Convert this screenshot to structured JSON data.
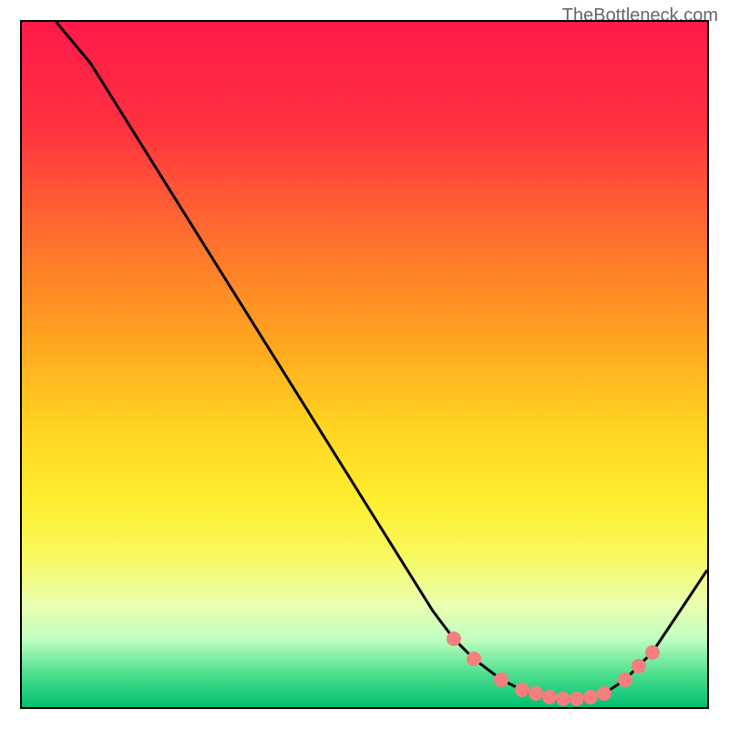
{
  "watermark": "TheBottleneck.com",
  "chart_data": {
    "type": "line",
    "title": "",
    "xlabel": "",
    "ylabel": "",
    "xlim": [
      0,
      100
    ],
    "ylim": [
      0,
      100
    ],
    "series": [
      {
        "name": "curve",
        "x": [
          5,
          10,
          15,
          20,
          25,
          30,
          35,
          40,
          45,
          50,
          55,
          60,
          63,
          66,
          70,
          74,
          78,
          82,
          85,
          88,
          92,
          96,
          100
        ],
        "y": [
          100,
          94,
          86,
          78,
          70,
          62,
          54,
          46,
          38,
          30,
          22,
          14,
          10,
          7,
          4,
          2,
          1,
          1,
          2,
          4,
          8,
          14,
          20
        ]
      }
    ],
    "dots": [
      {
        "x": 63,
        "y": 10
      },
      {
        "x": 66,
        "y": 7
      },
      {
        "x": 70,
        "y": 4
      },
      {
        "x": 73,
        "y": 2.5
      },
      {
        "x": 75,
        "y": 2
      },
      {
        "x": 77,
        "y": 1.5
      },
      {
        "x": 79,
        "y": 1.2
      },
      {
        "x": 81,
        "y": 1.2
      },
      {
        "x": 83,
        "y": 1.5
      },
      {
        "x": 85,
        "y": 2
      },
      {
        "x": 88,
        "y": 4
      },
      {
        "x": 90,
        "y": 6
      },
      {
        "x": 92,
        "y": 8
      }
    ],
    "gradient_stops": [
      {
        "offset": 0,
        "color": "#ff1a4a"
      },
      {
        "offset": 0.15,
        "color": "#ff3040"
      },
      {
        "offset": 0.3,
        "color": "#ff6a30"
      },
      {
        "offset": 0.45,
        "color": "#ffa020"
      },
      {
        "offset": 0.58,
        "color": "#ffd020"
      },
      {
        "offset": 0.7,
        "color": "#ffee30"
      },
      {
        "offset": 0.78,
        "color": "#f8f860"
      },
      {
        "offset": 0.85,
        "color": "#eaffb0"
      },
      {
        "offset": 0.9,
        "color": "#c0ffc0"
      },
      {
        "offset": 0.95,
        "color": "#50e090"
      },
      {
        "offset": 1.0,
        "color": "#00c070"
      }
    ]
  }
}
